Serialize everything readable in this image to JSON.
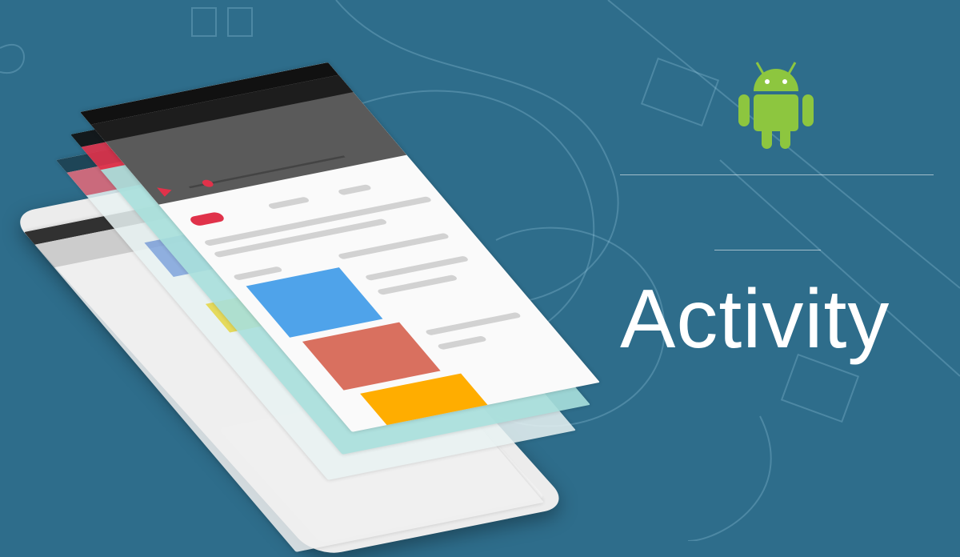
{
  "heading": "Activity",
  "logo": {
    "name": "android-robot-icon",
    "color": "#8dc63f"
  },
  "colors": {
    "background": "#2e6d8b",
    "blue_block": "#4fa3ea",
    "red_block": "#d9705f",
    "orange_block": "#ffad00",
    "accent_red": "#e0324a"
  }
}
